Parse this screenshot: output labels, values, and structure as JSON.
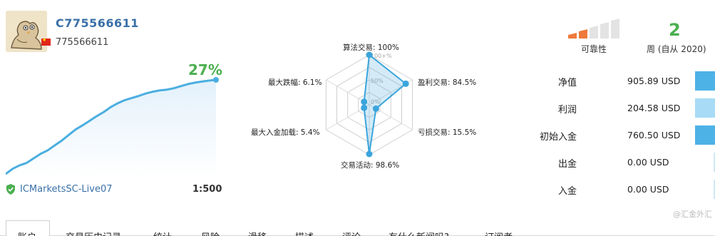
{
  "account": {
    "name": "C775566611",
    "number": "775566611",
    "growth": "27%",
    "server": "ICMarketsSC-Live07",
    "leverage": "1:500"
  },
  "growth_chart": {
    "x": [
      0,
      1,
      2,
      3,
      4,
      5,
      6,
      7,
      8,
      9,
      10,
      11,
      12,
      13,
      14,
      15,
      16,
      17,
      18,
      19,
      20,
      21,
      22,
      23,
      24,
      25,
      26,
      27,
      28,
      29,
      30
    ],
    "y": [
      0,
      1.5,
      2.5,
      3.2,
      4.5,
      5.8,
      6.8,
      8.2,
      9.6,
      11.2,
      12.8,
      14.0,
      15.3,
      16.6,
      17.8,
      19.2,
      20.3,
      21.2,
      21.8,
      22.4,
      23.1,
      23.6,
      24.0,
      24.2,
      24.6,
      25.2,
      25.8,
      26.2,
      26.5,
      26.8,
      27.0
    ],
    "line_color": "#4baee0",
    "fill_color": "#e3f1fb"
  },
  "radar": {
    "labels": [
      {
        "key": "algo",
        "text": "算法交易: 100%"
      },
      {
        "key": "profit",
        "text": "盈利交易: 84.5%"
      },
      {
        "key": "loss",
        "text": "亏损交易: 15.5%"
      },
      {
        "key": "activity",
        "text": "交易活动: 98.6%"
      },
      {
        "key": "deposit_load",
        "text": "最大入金加载: 5.4%"
      },
      {
        "key": "drawdown",
        "text": "最大跌幅: 6.1%"
      }
    ],
    "values": [
      100,
      84.5,
      15.5,
      98.6,
      5.4,
      6.1
    ],
    "grid_labels": [
      "100+%",
      "50%",
      "0%"
    ],
    "color": "#3aa5dc"
  },
  "reliability": {
    "label": "可靠性",
    "bars_filled": 2,
    "bars_total": 5,
    "filled_color": "#ee7a3a",
    "empty_color": "#e3e3e3"
  },
  "weeks": {
    "value": "2",
    "label": "周 (自从 2020)"
  },
  "stats": [
    {
      "name": "净值",
      "value": "905.89 USD",
      "bar_color": "#4db2e6",
      "bar_width": 28
    },
    {
      "name": "利润",
      "value": "204.58 USD",
      "bar_color": "#a8dbf6",
      "bar_width": 28
    },
    {
      "name": "初始入金",
      "value": "760.50 USD",
      "bar_color": "#4db2e6",
      "bar_width": 28
    },
    {
      "name": "出金",
      "value": "0.00 USD",
      "bar_color": "#cfe8f6",
      "bar_width": 2
    },
    {
      "name": "入金",
      "value": "0.00 USD",
      "bar_color": "#cfe8f6",
      "bar_width": 2
    }
  ],
  "tabs": [
    {
      "label": "账户",
      "active": true
    },
    {
      "label": "交易历史记录"
    },
    {
      "label": "统计"
    },
    {
      "label": "风险"
    },
    {
      "label": "滑移"
    },
    {
      "label": "描述"
    },
    {
      "label": "评论"
    },
    {
      "label": "有什么新闻吗?"
    },
    {
      "label": "订阅者"
    }
  ],
  "watermark": "@汇金外汇"
}
